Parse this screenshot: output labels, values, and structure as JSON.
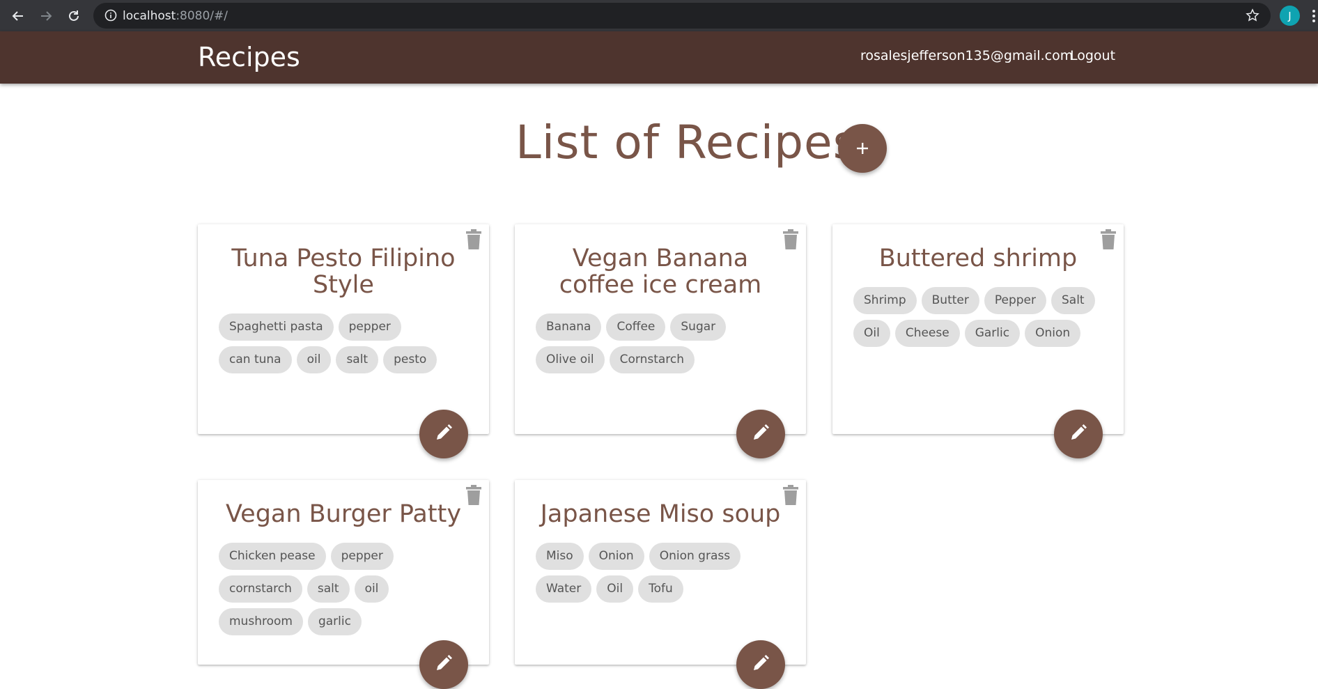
{
  "browser": {
    "url_host": "localhost",
    "url_rest": ":8080/#/",
    "profile_initial": "J"
  },
  "appbar": {
    "brand": "Recipes",
    "email": "rosalesjefferson135@gmail.com",
    "logout_label": "Logout"
  },
  "page": {
    "heading": "List of Recipes",
    "add_label": "+"
  },
  "colors": {
    "appbar": "#4e342e",
    "accent": "#795548",
    "chip": "#e0e0e0"
  },
  "recipes": [
    {
      "title": "Tuna Pesto Filipino Style",
      "ingredients": [
        "Spaghetti pasta",
        "pepper",
        "can tuna",
        "oil",
        "salt",
        "pesto"
      ]
    },
    {
      "title": "Vegan Banana coffee ice cream",
      "ingredients": [
        "Banana",
        "Coffee",
        "Sugar",
        "Olive oil",
        "Cornstarch"
      ]
    },
    {
      "title": "Buttered shrimp",
      "ingredients": [
        "Shrimp",
        "Butter",
        "Pepper",
        "Salt",
        "Oil",
        "Cheese",
        "Garlic",
        "Onion"
      ]
    },
    {
      "title": "Vegan Burger Patty",
      "ingredients": [
        "Chicken pease",
        "pepper",
        "cornstarch",
        "salt",
        "oil",
        "mushroom",
        "garlic"
      ]
    },
    {
      "title": "Japanese Miso soup",
      "ingredients": [
        "Miso",
        "Onion",
        "Onion grass",
        "Water",
        "Oil",
        "Tofu"
      ]
    }
  ]
}
